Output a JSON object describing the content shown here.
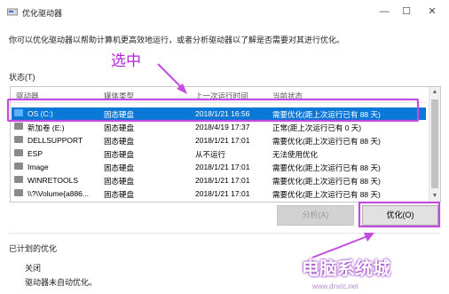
{
  "window": {
    "title": "优化驱动器",
    "minimize": "—",
    "maximize": "☐",
    "close": "✕"
  },
  "description": "你可以优化驱动器以帮助计算机更高效地运行，或者分析驱动器以了解是否需要对其进行优化。",
  "status_label": "状态(T)",
  "annotation": {
    "text": "选中",
    "color": "#b324d8"
  },
  "list": {
    "headers": {
      "drive": "驱动器",
      "media": "媒体类型",
      "last": "上一次运行时间",
      "state": "当前状态"
    },
    "rows": [
      {
        "drive": "OS (C:)",
        "media": "固态硬盘",
        "last": "2018/1/21 16:56",
        "state": "需要优化(距上次运行已有 88 天)"
      },
      {
        "drive": "新加卷 (E:)",
        "media": "固态硬盘",
        "last": "2018/4/19 17:37",
        "state": "正常(距上次运行已有 0 天)"
      },
      {
        "drive": "DELLSUPPORT",
        "media": "固态硬盘",
        "last": "2018/1/21 17:01",
        "state": "需要优化(距上次运行已有 88 天)"
      },
      {
        "drive": "ESP",
        "media": "固态硬盘",
        "last": "从不运行",
        "state": "无法使用优化"
      },
      {
        "drive": "Image",
        "media": "固态硬盘",
        "last": "2018/1/21 17:01",
        "state": "需要优化(距上次运行已有 88 天)"
      },
      {
        "drive": "WINRETOOLS",
        "media": "固态硬盘",
        "last": "2018/1/21 17:01",
        "state": "需要优化(距上次运行已有 88 天)"
      },
      {
        "drive": "\\\\?\\Volume{a886...",
        "media": "固态硬盘",
        "last": "2018/1/21 17:01",
        "state": "需要优化(距上次运行已有 88 天)"
      }
    ]
  },
  "buttons": {
    "analyze": "分析(A)",
    "optimize": "优化(O)"
  },
  "scheduled": {
    "label": "已计划的优化",
    "state": "关闭",
    "desc": "驱动器未自动优化。"
  },
  "watermark": {
    "text": "电脑系统城",
    "url": "www.dnxtc.net"
  }
}
